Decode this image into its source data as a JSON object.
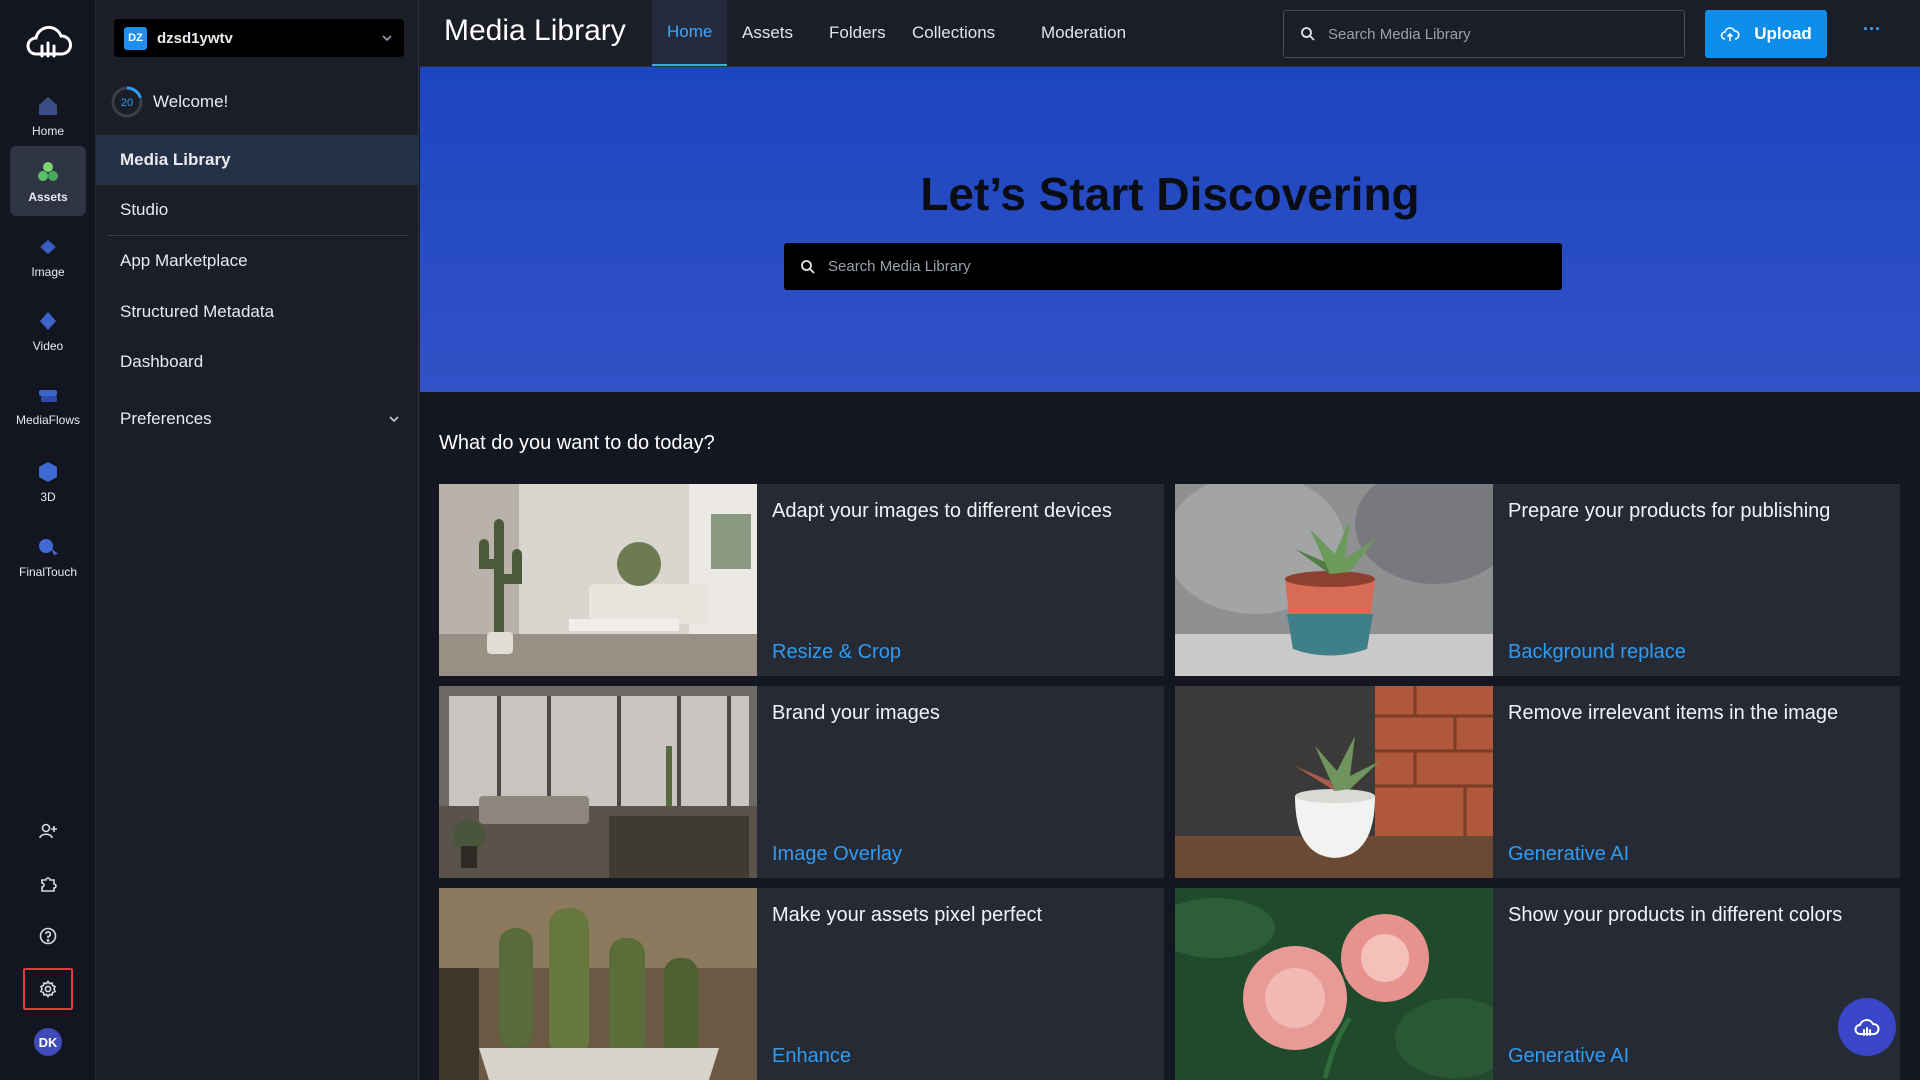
{
  "rail": {
    "items": [
      {
        "label": "Home",
        "icon": "home-icon"
      },
      {
        "label": "Assets",
        "icon": "assets-icon",
        "active": true
      },
      {
        "label": "Image",
        "icon": "image-icon"
      },
      {
        "label": "Video",
        "icon": "video-icon"
      },
      {
        "label": "MediaFlows",
        "icon": "mediaflows-icon"
      },
      {
        "label": "3D",
        "icon": "3d-icon"
      },
      {
        "label": "FinalTouch",
        "icon": "finaltouch-icon"
      }
    ],
    "bottom_icons": [
      "invite-user-icon",
      "puzzle-icon",
      "help-icon",
      "gear-icon"
    ],
    "avatar_initials": "DK"
  },
  "panel": {
    "cloud_badge": "DZ",
    "cloud_name": "dzsd1ywtv",
    "welcome_progress": "20",
    "welcome_label": "Welcome!",
    "nav": [
      {
        "label": "Media Library",
        "active": true
      },
      {
        "label": "Studio"
      },
      {
        "label": "App Marketplace"
      },
      {
        "label": "Structured Metadata"
      },
      {
        "label": "Dashboard"
      },
      {
        "label": "Preferences"
      }
    ]
  },
  "topbar": {
    "title": "Media Library",
    "tabs": [
      {
        "label": "Home",
        "active": true
      },
      {
        "label": "Assets"
      },
      {
        "label": "Folders"
      },
      {
        "label": "Collections"
      },
      {
        "label": "Moderation"
      }
    ],
    "search_placeholder": "Search Media Library",
    "upload_label": "Upload",
    "more_label": "···"
  },
  "hero": {
    "title": "Let’s Start Discovering",
    "search_placeholder": "Search Media Library"
  },
  "main": {
    "section_title": "What do you want to do today?",
    "cards": [
      {
        "title": "Adapt your images to different devices",
        "link": "Resize & Crop"
      },
      {
        "title": "Prepare your products for publishing",
        "link": "Background replace"
      },
      {
        "title": "Brand your images",
        "link": "Image Overlay"
      },
      {
        "title": "Remove irrelevant items in the image",
        "link": "Generative AI"
      },
      {
        "title": "Make your assets pixel perfect",
        "link": "Enhance"
      },
      {
        "title": "Show your products in different colors",
        "link": "Generative AI"
      }
    ]
  },
  "colors": {
    "accent": "#3ea6ff",
    "upload": "#0e8ee9",
    "hero_top": "#1c46bf",
    "hero_bottom": "#3251c7",
    "highlight": "#e23b3b"
  }
}
